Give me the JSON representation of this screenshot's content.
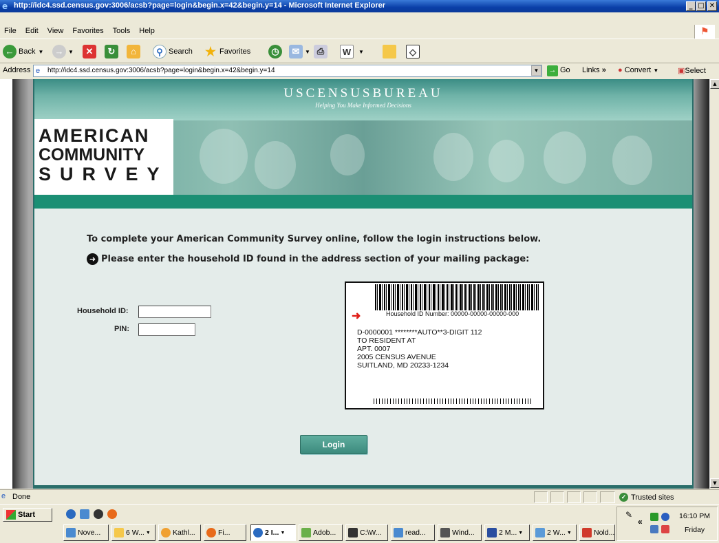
{
  "window": {
    "title": "http://idc4.ssd.census.gov:3006/acsb?page=login&begin.x=42&begin.y=14 - Microsoft Internet Explorer",
    "minimize": "_",
    "maximize": "□",
    "close": "✕"
  },
  "menu": [
    "File",
    "Edit",
    "View",
    "Favorites",
    "Tools",
    "Help"
  ],
  "toolbar": {
    "back": "Back",
    "search": "Search",
    "favorites": "Favorites"
  },
  "address": {
    "label": "Address",
    "url": "http://idc4.ssd.census.gov:3006/acsb?page=login&begin.x=42&begin.y=14",
    "go": "Go",
    "links": "Links",
    "convert": "Convert",
    "select": "Select"
  },
  "census": {
    "bureau": "USCENSUSBUREAU",
    "tagline": "Helping You Make Informed Decisions",
    "logo": [
      "AMERICAN",
      "COMMUNITY",
      "SURVEY"
    ],
    "intro": "To complete your American Community Survey online, follow the login instructions below.",
    "prompt": "Please enter the household ID found in the address section of your mailing package:",
    "household_label": "Household ID:",
    "household_value": "",
    "pin_label": "PIN:",
    "pin_value": "",
    "mail_label": {
      "hh_number": "Household ID Number: 00000-00000-00000-000",
      "lines": [
        "D-0000001 ********AUTO**3-DIGIT 112",
        "TO RESIDENT AT",
        "APT. 0007",
        "2005 CENSUS AVENUE",
        "SUITLAND, MD 20233-1234"
      ]
    },
    "login_button": "Login"
  },
  "status": {
    "text": "Done",
    "zone": "Trusted sites"
  },
  "taskbar": {
    "start": "Start",
    "tasks": [
      "Nove...",
      "6 W...",
      "Kathl...",
      "Fi...",
      "2 I...",
      "Adob...",
      "C:\\W...",
      "read...",
      "Wind...",
      "2 M...",
      "2 W...",
      "Nold..."
    ],
    "time": "16:10 PM",
    "day": "Friday"
  }
}
